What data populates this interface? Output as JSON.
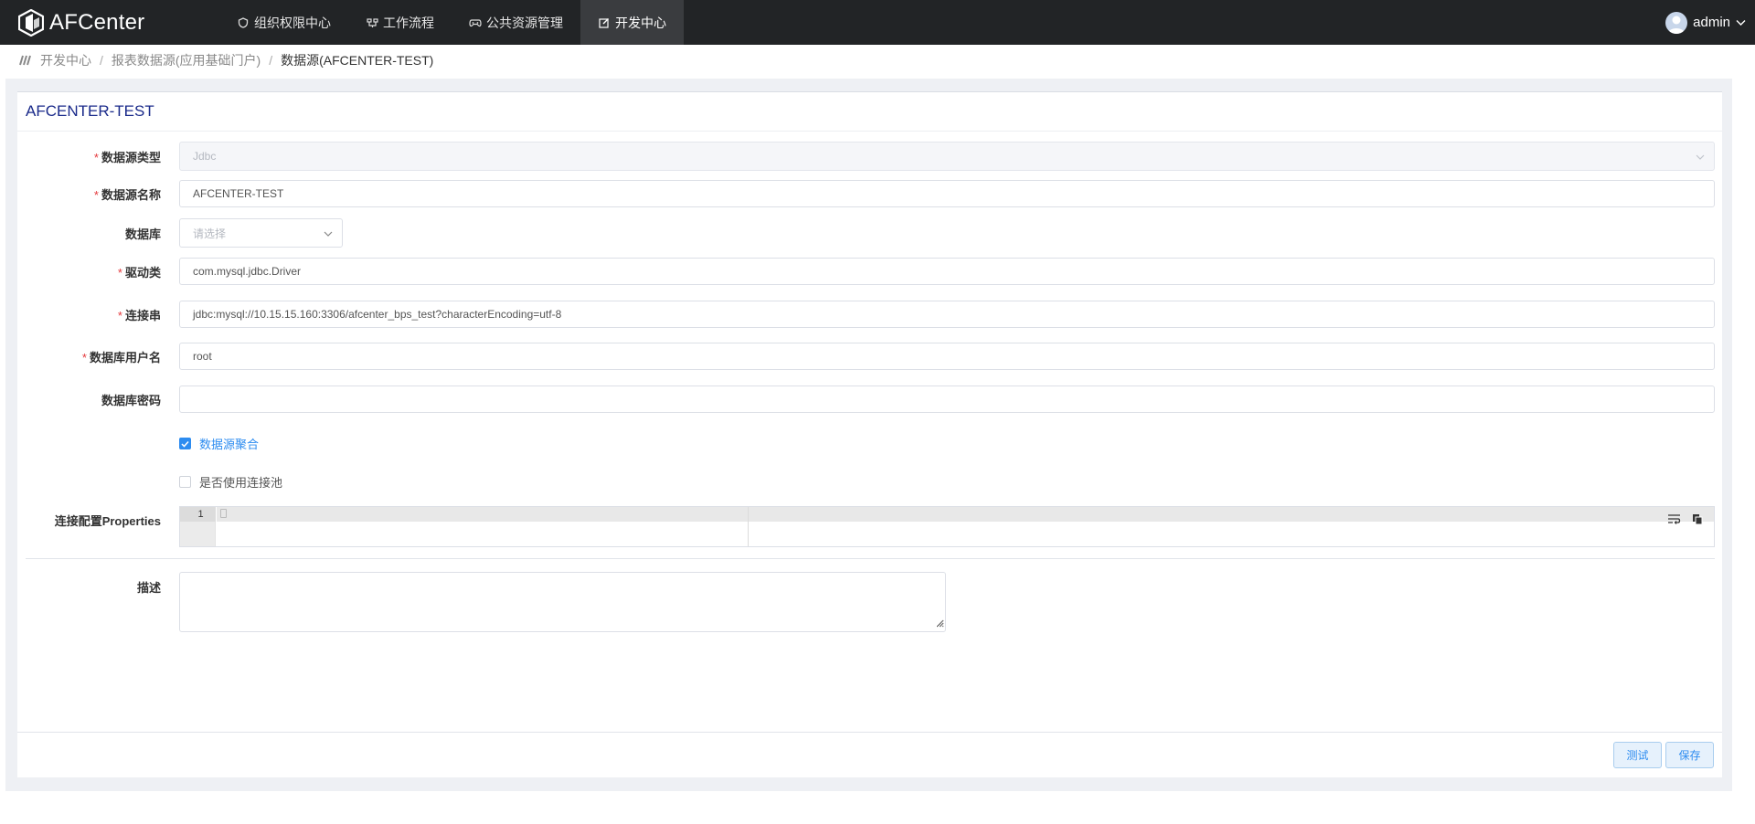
{
  "brand": {
    "name": "AFCenter"
  },
  "nav": {
    "items": [
      {
        "label": "组织权限中心",
        "icon": "shield-icon"
      },
      {
        "label": "工作流程",
        "icon": "workflow-icon"
      },
      {
        "label": "公共资源管理",
        "icon": "gamepad-icon"
      },
      {
        "label": "开发中心",
        "icon": "edit-icon",
        "active": true
      }
    ]
  },
  "user": {
    "name": "admin"
  },
  "breadcrumb": {
    "items": [
      "开发中心",
      "报表数据源(应用基础门户)",
      "数据源(AFCENTER-TEST)"
    ]
  },
  "panel": {
    "title": "AFCENTER-TEST"
  },
  "form": {
    "type": {
      "label": "数据源类型",
      "value": "Jdbc"
    },
    "name": {
      "label": "数据源名称",
      "value": "AFCENTER-TEST"
    },
    "database": {
      "label": "数据库",
      "placeholder": "请选择"
    },
    "driver": {
      "label": "驱动类",
      "value": "com.mysql.jdbc.Driver"
    },
    "url": {
      "label": "连接串",
      "value": "jdbc:mysql://10.15.15.160:3306/afcenter_bps_test?characterEncoding=utf-8"
    },
    "username": {
      "label": "数据库用户名",
      "value": "root"
    },
    "password": {
      "label": "数据库密码",
      "value": ""
    },
    "aggregate": {
      "label": "数据源聚合",
      "checked": true
    },
    "pool": {
      "label": "是否使用连接池",
      "checked": false
    },
    "properties": {
      "label": "连接配置Properties",
      "line_number": "1"
    },
    "description": {
      "label": "描述",
      "value": ""
    }
  },
  "footer": {
    "test_label": "测试",
    "save_label": "保存"
  },
  "colors": {
    "topbar": "#222426",
    "accent": "#2d8cf0",
    "title": "#1a2a8a",
    "required": "#e4393c"
  }
}
